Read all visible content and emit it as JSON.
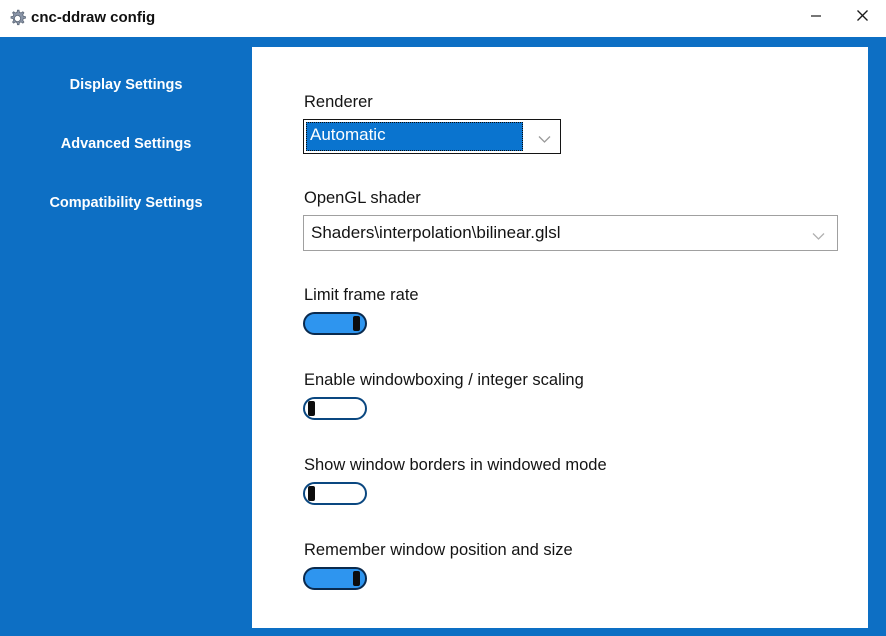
{
  "window": {
    "title": "cnc-ddraw config",
    "icon": "gear-icon",
    "minimize_label": "–",
    "close_label": "✕",
    "accent_color": "#0d6fc4"
  },
  "sidebar": {
    "background_color": "#0d6fc4",
    "items": [
      {
        "label": "Display Settings",
        "active": true
      },
      {
        "label": "Advanced Settings",
        "active": false
      },
      {
        "label": "Compatibility Settings",
        "active": false
      }
    ]
  },
  "main": {
    "fields": [
      {
        "label": "Renderer",
        "type": "combobox",
        "value": "Automatic",
        "focused": true,
        "highlight_color": "#0a74cf"
      },
      {
        "label": "OpenGL shader",
        "type": "combobox",
        "value": "Shaders\\interpolation\\bilinear.glsl",
        "focused": false
      },
      {
        "label": "Limit frame rate",
        "type": "toggle",
        "state": "on"
      },
      {
        "label": "Enable windowboxing / integer scaling",
        "type": "toggle",
        "state": "off"
      },
      {
        "label": "Show window borders in windowed mode",
        "type": "toggle",
        "state": "off"
      },
      {
        "label": "Remember window position and size",
        "type": "toggle",
        "state": "on"
      }
    ]
  }
}
